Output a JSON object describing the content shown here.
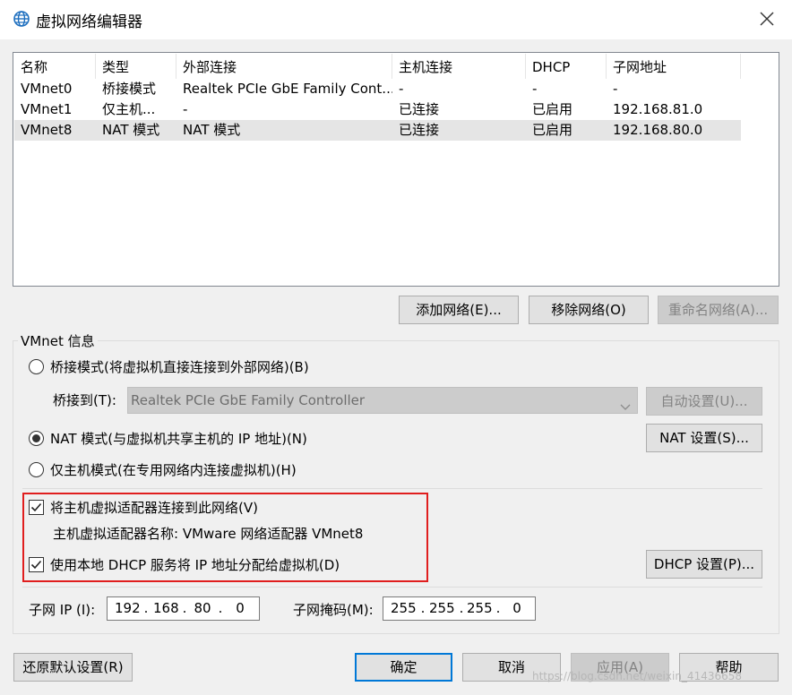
{
  "window": {
    "title": "虚拟网络编辑器"
  },
  "network_table": {
    "columns": [
      "名称",
      "类型",
      "外部连接",
      "主机连接",
      "DHCP",
      "子网地址"
    ],
    "rows": [
      [
        "VMnet0",
        "桥接模式",
        "Realtek PCIe GbE Family Cont...",
        "-",
        "-",
        "-"
      ],
      [
        "VMnet1",
        "仅主机...",
        "-",
        "已连接",
        "已启用",
        "192.168.81.0"
      ],
      [
        "VMnet8",
        "NAT 模式",
        "NAT 模式",
        "已连接",
        "已启用",
        "192.168.80.0"
      ]
    ],
    "selected_row": 2
  },
  "table_buttons": {
    "add": "添加网络(E)...",
    "remove": "移除网络(O)",
    "rename": "重命名网络(A)..."
  },
  "vmnet_info": {
    "title": "VMnet 信息",
    "bridged_radio": "桥接模式(将虚拟机直接连接到外部网络)(B)",
    "bridge_to_label": "桥接到(T):",
    "bridge_to_value": "Realtek PCIe GbE Family Controller",
    "auto_settings": "自动设置(U)...",
    "nat_radio": "NAT 模式(与虚拟机共享主机的 IP 地址)(N)",
    "nat_settings": "NAT 设置(S)...",
    "hostonly_radio": "仅主机模式(在专用网络内连接虚拟机)(H)",
    "selected_mode": "nat",
    "connect_adapter": "将主机虚拟适配器连接到此网络(V)",
    "connect_adapter_checked": true,
    "adapter_name_label": "主机虚拟适配器名称: VMware 网络适配器 VMnet8",
    "use_dhcp": "使用本地 DHCP 服务将 IP 地址分配给虚拟机(D)",
    "use_dhcp_checked": true,
    "dhcp_settings": "DHCP 设置(P)...",
    "subnet_ip_label": "子网 IP (I):",
    "subnet_ip": [
      "192",
      "168",
      "80",
      "0"
    ],
    "subnet_mask_label": "子网掩码(M):",
    "subnet_mask": [
      "255",
      "255",
      "255",
      "0"
    ]
  },
  "footer": {
    "restore": "还原默认设置(R)",
    "ok": "确定",
    "cancel": "取消",
    "apply": "应用(A)",
    "help": "帮助"
  },
  "watermark": "https://blog.csdn.net/weixin_41436658",
  "colors": {
    "highlight_border": "#e01e1e",
    "window_bg": "#f0f0f0",
    "selected_row": "#e5e5e5"
  }
}
